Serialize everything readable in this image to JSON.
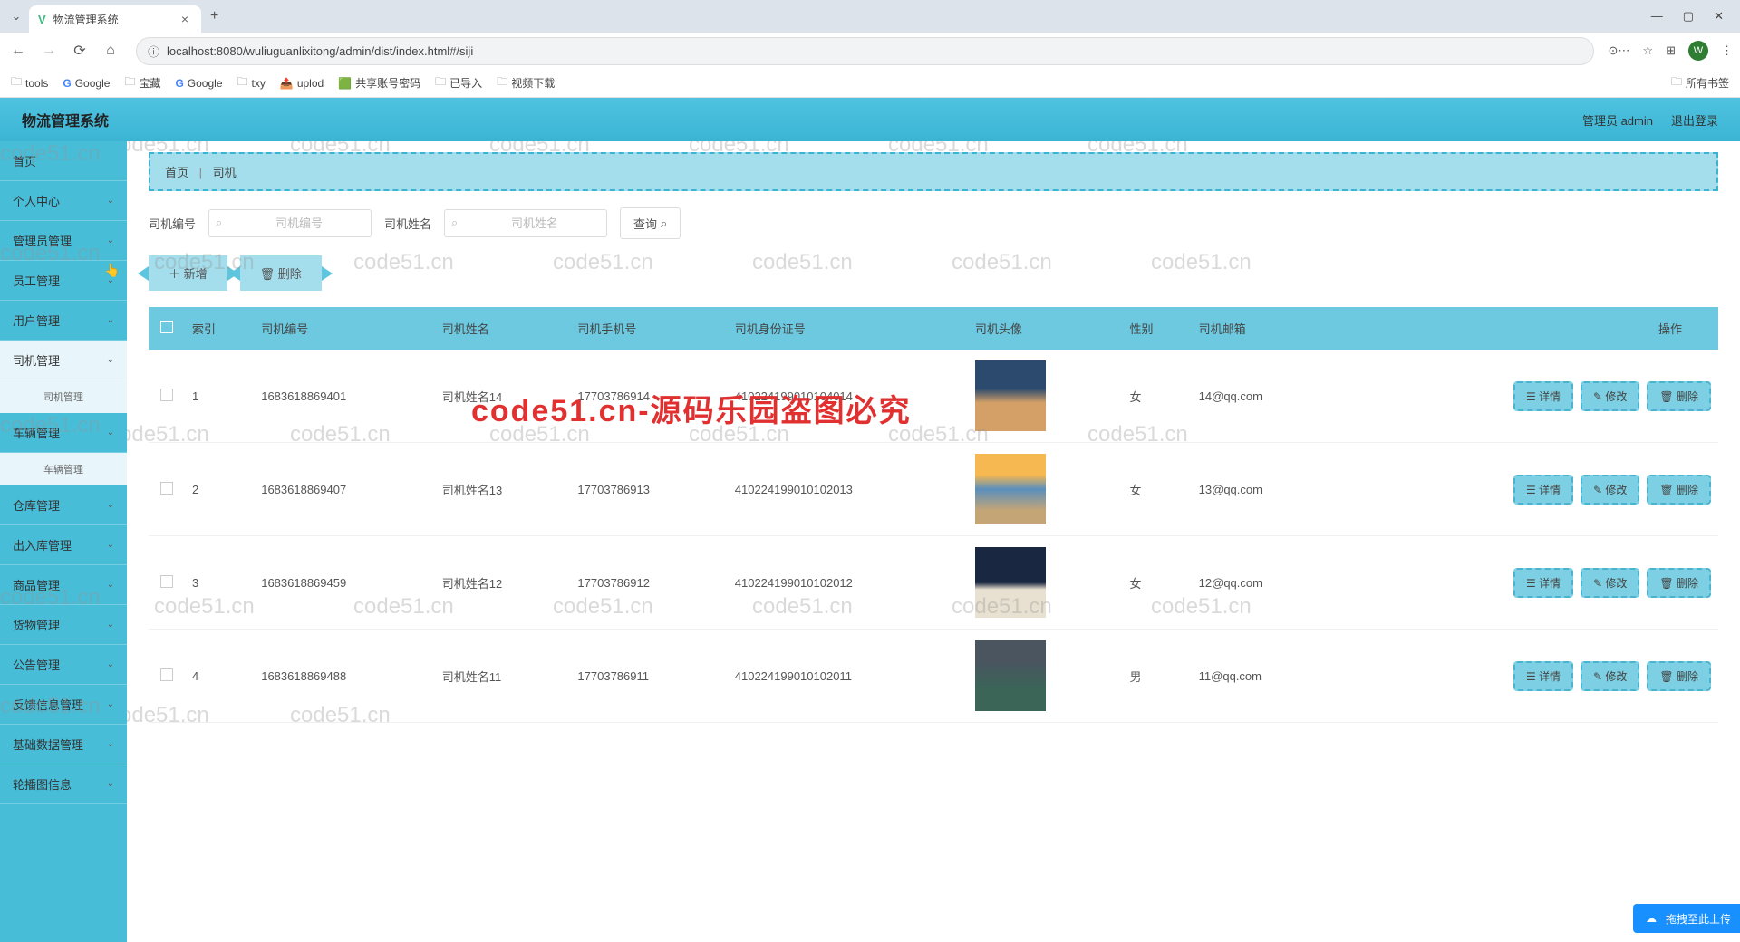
{
  "browser": {
    "tab_title": "物流管理系统",
    "url": "localhost:8080/wuliuguanlixitong/admin/dist/index.html#/siji",
    "bookmarks": [
      "tools",
      "Google",
      "宝藏",
      "Google",
      "txy",
      "uplod",
      "共享账号密码",
      "已导入",
      "视频下载"
    ],
    "all_bookmarks": "所有书签"
  },
  "header": {
    "app_title": "物流管理系统",
    "user_label": "管理员 admin",
    "logout": "退出登录"
  },
  "sidebar": {
    "items": [
      {
        "label": "首页",
        "has_children": false
      },
      {
        "label": "个人中心",
        "has_children": true
      },
      {
        "label": "管理员管理",
        "has_children": true
      },
      {
        "label": "员工管理",
        "has_children": true
      },
      {
        "label": "用户管理",
        "has_children": true
      },
      {
        "label": "司机管理",
        "has_children": true,
        "active": true,
        "sub": "司机管理"
      },
      {
        "label": "车辆管理",
        "has_children": true,
        "sub": "车辆管理"
      },
      {
        "label": "仓库管理",
        "has_children": true
      },
      {
        "label": "出入库管理",
        "has_children": true
      },
      {
        "label": "商品管理",
        "has_children": true
      },
      {
        "label": "货物管理",
        "has_children": true
      },
      {
        "label": "公告管理",
        "has_children": true
      },
      {
        "label": "反馈信息管理",
        "has_children": true
      },
      {
        "label": "基础数据管理",
        "has_children": true
      },
      {
        "label": "轮播图信息",
        "has_children": true
      }
    ]
  },
  "breadcrumb": {
    "home": "首页",
    "current": "司机"
  },
  "search": {
    "field1_label": "司机编号",
    "field1_placeholder": "司机编号",
    "field2_label": "司机姓名",
    "field2_placeholder": "司机姓名",
    "query_btn": "查询"
  },
  "actions": {
    "add": "新增",
    "delete": "删除"
  },
  "table": {
    "headers": [
      "索引",
      "司机编号",
      "司机姓名",
      "司机手机号",
      "司机身份证号",
      "司机头像",
      "性别",
      "司机邮箱",
      "操作"
    ],
    "row_actions": {
      "detail": "详情",
      "edit": "修改",
      "del": "删除"
    },
    "rows": [
      {
        "idx": "1",
        "code": "1683618869401",
        "name": "司机姓名14",
        "phone": "17703786914",
        "idcard": "410224199010104014",
        "gender": "女",
        "email": "14@qq.com"
      },
      {
        "idx": "2",
        "code": "1683618869407",
        "name": "司机姓名13",
        "phone": "17703786913",
        "idcard": "410224199010102013",
        "gender": "女",
        "email": "13@qq.com"
      },
      {
        "idx": "3",
        "code": "1683618869459",
        "name": "司机姓名12",
        "phone": "17703786912",
        "idcard": "410224199010102012",
        "gender": "女",
        "email": "12@qq.com"
      },
      {
        "idx": "4",
        "code": "1683618869488",
        "name": "司机姓名11",
        "phone": "17703786911",
        "idcard": "410224199010102011",
        "gender": "男",
        "email": "11@qq.com"
      }
    ]
  },
  "watermark_text": "code51.cn",
  "watermark_banner": "code51.cn-源码乐园盗图必究",
  "upload_hint": "拖拽至此上传"
}
